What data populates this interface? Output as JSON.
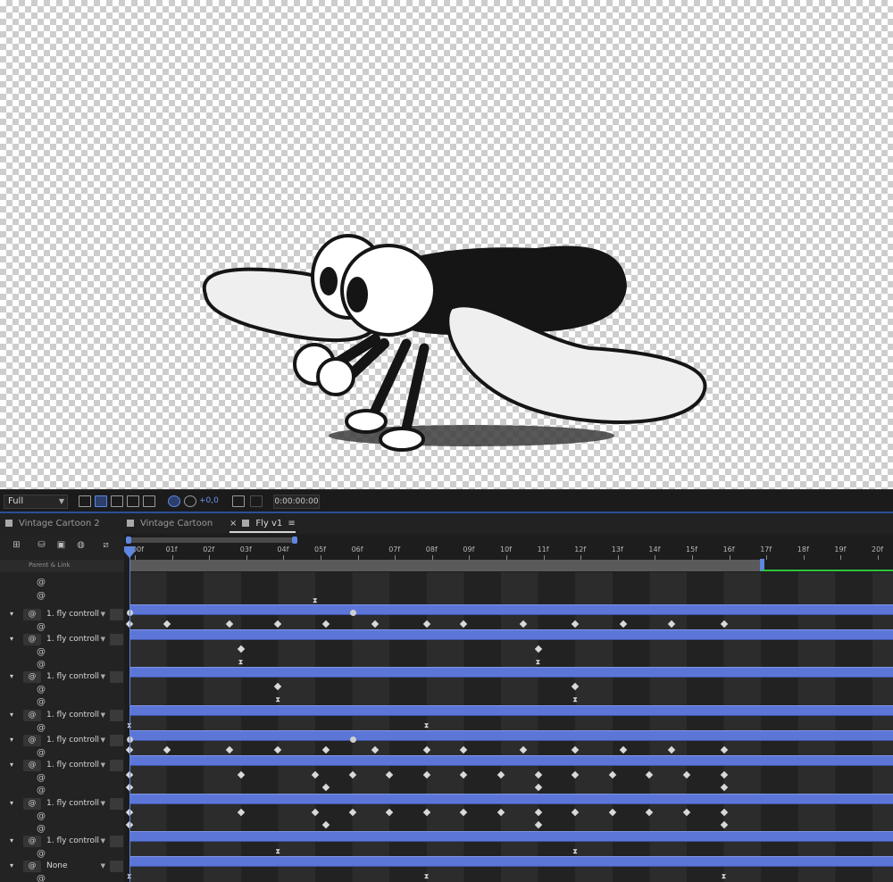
{
  "viewer": {
    "toolbar": {
      "resolution": "Full",
      "exposure": "+0,0",
      "timecode": "0:00:00:00",
      "icons": [
        "region-of-interest-icon",
        "transparency-grid-icon",
        "mask-visibility-icon",
        "guides-icon",
        "3d-view-icon",
        "color-management-icon",
        "exposure-reset-icon",
        "snapshot-icon",
        "show-snapshot-icon"
      ]
    }
  },
  "tabs": [
    {
      "label": "Vintage Cartoon 2",
      "active": false
    },
    {
      "label": "Vintage Cartoon",
      "active": false
    },
    {
      "label": "Fly v1",
      "active": true
    }
  ],
  "timeline": {
    "parent_header": "Parent & Link",
    "ruler": [
      "00f",
      "01f",
      "02f",
      "03f",
      "04f",
      "05f",
      "06f",
      "07f",
      "08f",
      "09f",
      "10f",
      "11f",
      "12f",
      "13f",
      "14f",
      "15f",
      "16f",
      "17f",
      "18f",
      "19f",
      "20f"
    ],
    "layers": [
      {
        "parent": "1. fly controll"
      },
      {
        "parent": "1. fly controll"
      },
      {
        "parent": "1. fly controll"
      },
      {
        "parent": "1. fly controll"
      },
      {
        "parent": "1. fly controll"
      },
      {
        "parent": "1. fly controll"
      },
      {
        "parent": "1. fly controll"
      },
      {
        "parent": "1. fly controll"
      },
      {
        "parent": "None"
      }
    ]
  },
  "colors": {
    "accent_blue": "#5f86e0",
    "layer_bar": "#5c76d8",
    "range_green": "#2ec43c"
  }
}
